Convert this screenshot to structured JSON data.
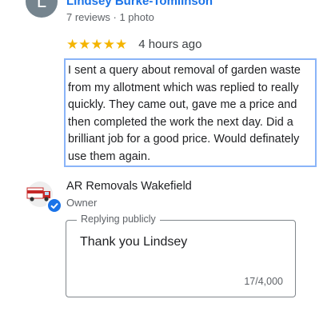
{
  "review": {
    "avatar_letter": "L",
    "avatar_color": "#75848e",
    "author_name": "Lindsey Burke-Tomlinson",
    "author_meta": "7 reviews · 1 photo",
    "stars": "★★★★★",
    "rating": 5,
    "time": "4 hours ago",
    "text": "I sent a query about removal of garden waste from my allotment which was replied to really quickly. They came out, gave me a price and then completed the work the next day. Did a brilliant job for a good price. Would definately use them again."
  },
  "owner_reply": {
    "logo_icon": "removal-van-logo-icon",
    "verified_icon": "verified-check-icon",
    "business_name": "AR Removals Wakefield",
    "role": "Owner",
    "field_label": "Replying publicly",
    "field_value": "Thank you Lindsey",
    "char_counter": "17/4,000"
  },
  "colors": {
    "link_blue": "#1a73e8",
    "star_gold": "#f4b400",
    "selection_border": "#8ab4f8"
  }
}
